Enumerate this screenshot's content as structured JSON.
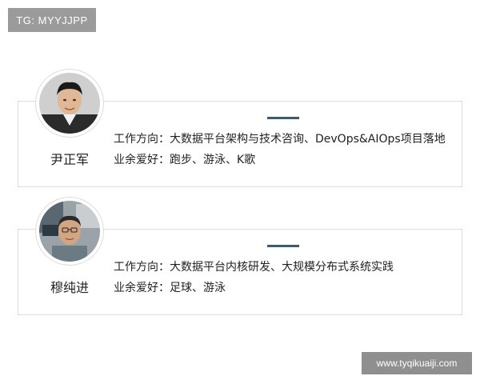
{
  "watermark": {
    "tg_label": "TG: MYYJJPP",
    "site_label": "www.tyqikuaiji.com"
  },
  "profiles": [
    {
      "name": "尹正军",
      "work_direction": "工作方向：大数据平台架构与技术咨询、DevOps&AIOps项目落地",
      "hobbies": "业余爱好：跑步、游泳、K歌"
    },
    {
      "name": "穆纯进",
      "work_direction": "工作方向：大数据平台内核研发、大规模分布式系统实践",
      "hobbies": "业余爱好：足球、游泳"
    }
  ],
  "colors": {
    "accent": "#3e5b6a",
    "border": "#dcdcdc"
  }
}
